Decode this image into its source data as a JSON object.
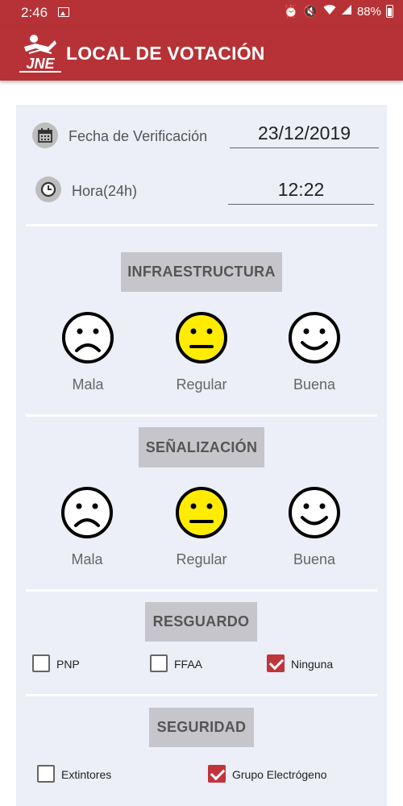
{
  "status_bar": {
    "time": "2:46",
    "battery": "88%"
  },
  "app_bar": {
    "logo_text": "JNE",
    "title": "LOCAL DE VOTACIÓN"
  },
  "form": {
    "fecha": {
      "label": "Fecha de Verificación",
      "value": "23/12/2019",
      "icon": "calendar-icon"
    },
    "hora": {
      "label": "Hora(24h)",
      "value": "12:22",
      "icon": "clock-icon"
    }
  },
  "sections": {
    "infraestructura": {
      "title": "INFRAESTRUCTURA",
      "options": [
        {
          "label": "Mala",
          "face": "sad",
          "selected": false
        },
        {
          "label": "Regular",
          "face": "neutral",
          "selected": true
        },
        {
          "label": "Buena",
          "face": "happy",
          "selected": false
        }
      ]
    },
    "senalizacion": {
      "title": "SEÑALIZACIÓN",
      "options": [
        {
          "label": "Mala",
          "face": "sad",
          "selected": false
        },
        {
          "label": "Regular",
          "face": "neutral",
          "selected": true
        },
        {
          "label": "Buena",
          "face": "happy",
          "selected": false
        }
      ]
    },
    "resguardo": {
      "title": "RESGUARDO",
      "options": [
        {
          "label": "PNP",
          "checked": false
        },
        {
          "label": "FFAA",
          "checked": false
        },
        {
          "label": "Ninguna",
          "checked": true
        }
      ]
    },
    "seguridad": {
      "title": "SEGURIDAD",
      "options": [
        {
          "label": "Extintores",
          "checked": false
        },
        {
          "label": "Grupo Electrógeno",
          "checked": true
        }
      ]
    }
  },
  "colors": {
    "primary": "#b63236",
    "selected_face": "#ffec00",
    "checkbox_checked": "#c0343c",
    "card_bg": "#eceef8"
  }
}
